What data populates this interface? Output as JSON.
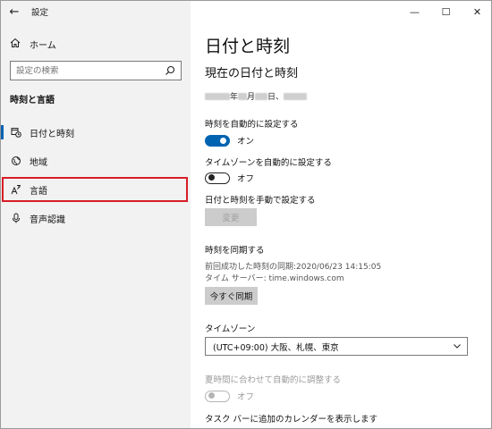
{
  "app": {
    "title": "設定"
  },
  "sidebar": {
    "home_label": "ホーム",
    "search_placeholder": "設定の検索",
    "section_title": "時刻と言語",
    "items": [
      {
        "label": "日付と時刻",
        "icon": "calendar-clock-icon"
      },
      {
        "label": "地域",
        "icon": "globe-icon"
      },
      {
        "label": "言語",
        "icon": "language-icon"
      },
      {
        "label": "音声認識",
        "icon": "microphone-icon"
      }
    ]
  },
  "main": {
    "page_title": "日付と時刻",
    "current_heading": "現在の日付と時刻",
    "date_year_suffix": "年",
    "date_month_suffix": "月",
    "date_day_suffix": "日、",
    "auto_time_label": "時刻を自動的に設定する",
    "auto_time_state": "オン",
    "auto_tz_label": "タイムゾーンを自動的に設定する",
    "auto_tz_state": "オフ",
    "manual_label": "日付と時刻を手動で設定する",
    "change_button": "変更",
    "sync_heading": "時刻を同期する",
    "last_sync": "前回成功した時刻の同期:2020/06/23 14:15:05",
    "time_server": "タイム サーバー: time.windows.com",
    "sync_button": "今すぐ同期",
    "tz_label": "タイムゾーン",
    "tz_value": "(UTC+09:00) 大阪、札幌、東京",
    "dst_label": "夏時間に合わせて自動的に調整する",
    "dst_state": "オフ",
    "calendar_label": "タスク バーに追加のカレンダーを表示します"
  },
  "colors": {
    "accent": "#0063b1",
    "highlight_border": "#d71d28",
    "sidebar_bg": "#f2f2f2"
  }
}
